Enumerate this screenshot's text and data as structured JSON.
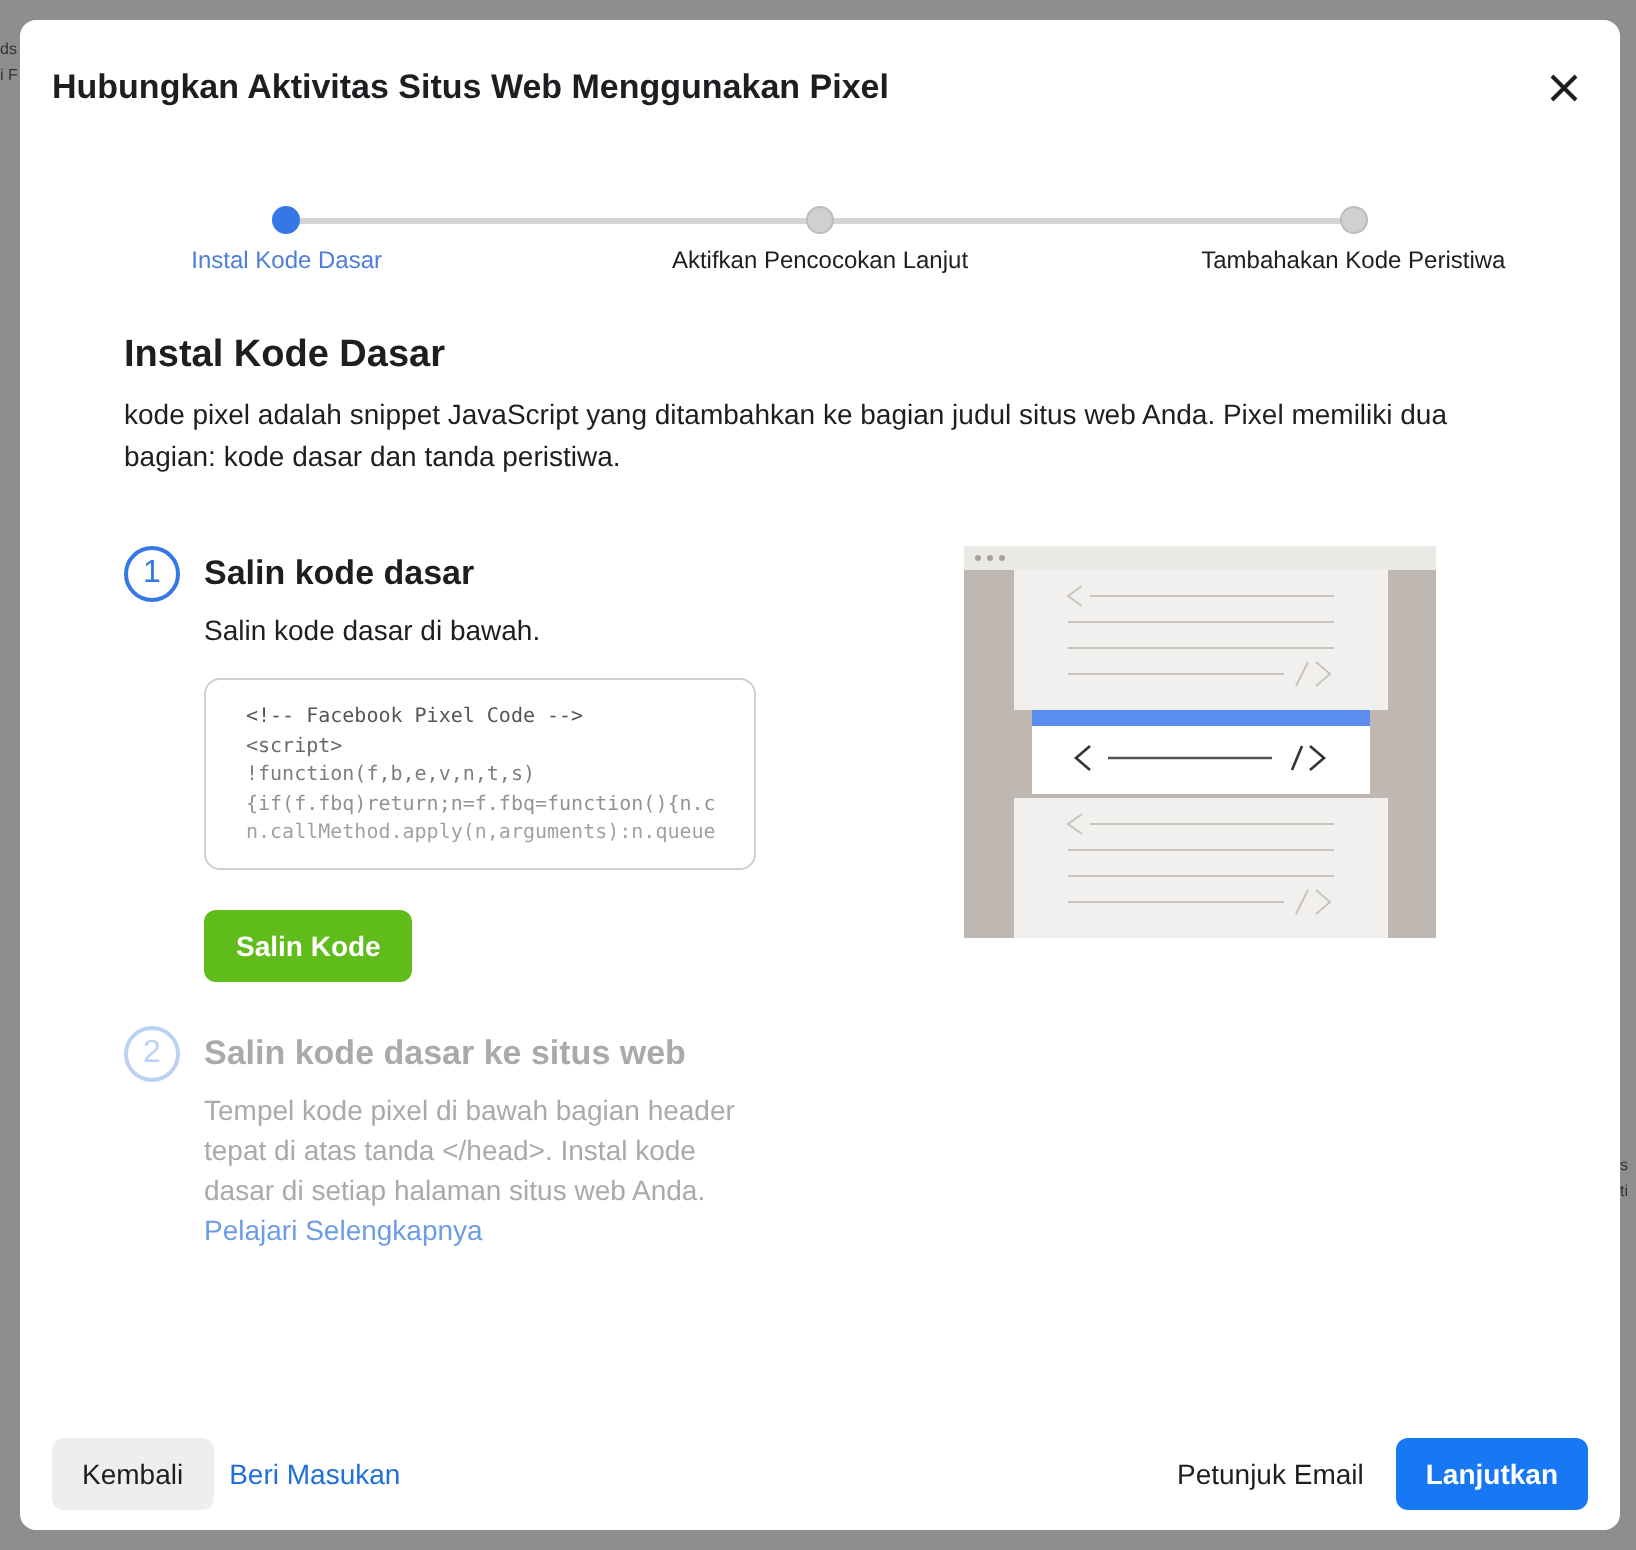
{
  "background_page": {
    "left_fragments": [
      "ds",
      "i F"
    ],
    "right_fragments": [
      "s",
      "ti"
    ]
  },
  "dialog": {
    "title": "Hubungkan Aktivitas Situs Web Menggunakan Pixel"
  },
  "stepper": [
    {
      "label": "Instal Kode Dasar",
      "selected": true
    },
    {
      "label": "Aktifkan Pencocokan Lanjut",
      "selected": false
    },
    {
      "label": "Tambahakan Kode Peristiwa",
      "selected": false
    }
  ],
  "section": {
    "heading": "Instal Kode Dasar",
    "description": "kode pixel adalah snippet JavaScript yang ditambahkan ke bagian judul situs web Anda. Pixel memiliki dua bagian: kode dasar dan tanda peristiwa."
  },
  "steps": [
    {
      "number": "1",
      "title": "Salin kode dasar",
      "active": true,
      "text": "Salin kode dasar di bawah.",
      "code_lines": [
        "<!-- Facebook Pixel Code -->",
        "<script>",
        "!function(f,b,e,v,n,t,s)",
        "{if(f.fbq)return;n=f.fbq=function(){n.c",
        "n.callMethod.apply(n,arguments):n.queue"
      ],
      "button": "Salin Kode"
    },
    {
      "number": "2",
      "title": "Salin kode dasar ke situs web",
      "active": false,
      "text": "Tempel kode pixel di bawah bagian header tepat di atas tanda </head>. Instal kode dasar di setiap halaman situs web Anda.",
      "link": "Pelajari Selengkapnya"
    }
  ],
  "footer": {
    "back": "Kembali",
    "feedback": "Beri Masukan",
    "email": "Petunjuk Email",
    "next": "Lanjutkan"
  }
}
